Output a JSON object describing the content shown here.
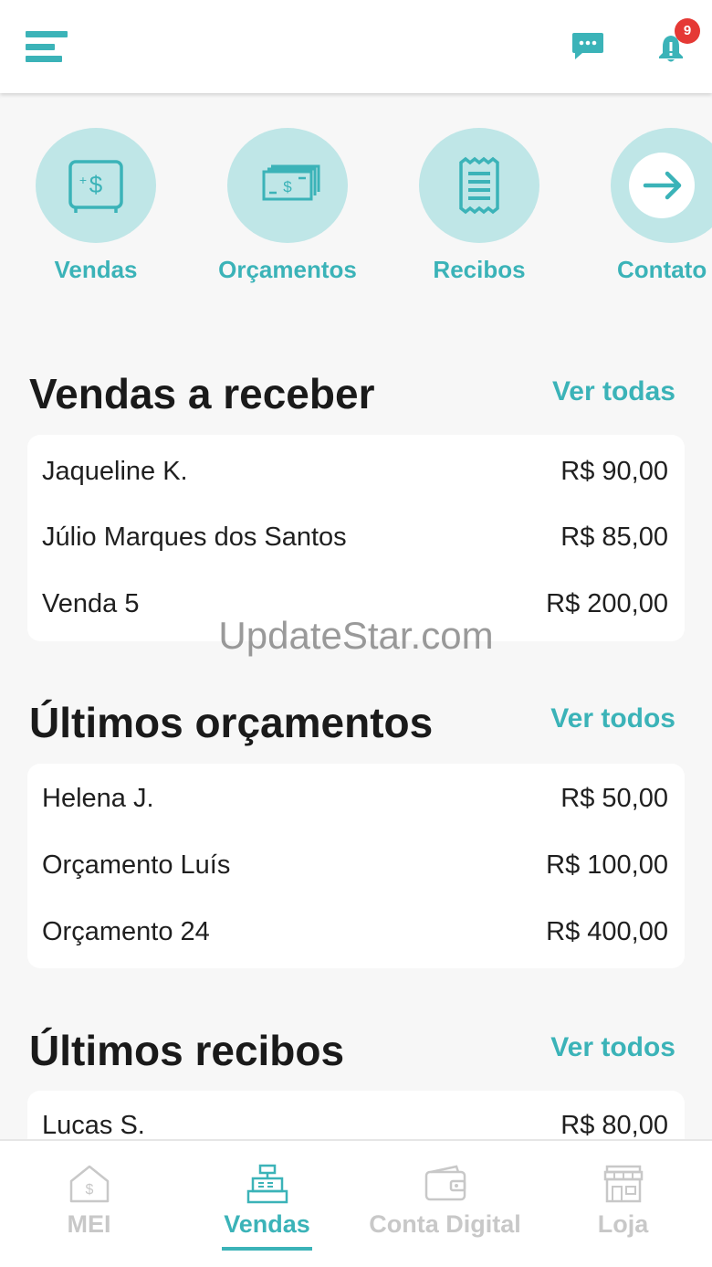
{
  "header": {
    "menu_icon": "hamburger-menu-icon",
    "chat_icon": "chat-bubble-icon",
    "bell_icon": "bell-icon",
    "notification_count": "9",
    "accent": "#3bb3b8",
    "badge_color": "#e53935"
  },
  "shortcuts": [
    {
      "label": "Vendas",
      "icon": "safe-money-icon"
    },
    {
      "label": "Orçamentos",
      "icon": "banknotes-icon"
    },
    {
      "label": "Recibos",
      "icon": "receipt-icon"
    },
    {
      "label": "Contato",
      "icon": "arrow-right-icon"
    }
  ],
  "sales": {
    "title": "Vendas a receber",
    "see_all": "Ver todas",
    "rows": [
      {
        "name": "Jaqueline K.",
        "amount": "R$ 90,00"
      },
      {
        "name": "Júlio Marques dos Santos",
        "amount": "R$ 85,00"
      },
      {
        "name": "Venda 5",
        "amount": "R$ 200,00"
      }
    ]
  },
  "quotes": {
    "title": "Últimos orçamentos",
    "see_all": "Ver todos",
    "rows": [
      {
        "name": "Helena J.",
        "amount": "R$ 50,00"
      },
      {
        "name": "Orçamento Luís",
        "amount": "R$ 100,00"
      },
      {
        "name": "Orçamento 24",
        "amount": "R$ 400,00"
      }
    ]
  },
  "receipts": {
    "title": "Últimos recibos",
    "see_all": "Ver todos",
    "rows": [
      {
        "name": "Lucas S.",
        "amount": "R$ 80,00"
      }
    ]
  },
  "watermark": "UpdateStar.com",
  "bottom_nav": [
    {
      "label": "MEI",
      "icon": "house-money-icon",
      "active": false
    },
    {
      "label": "Vendas",
      "icon": "cash-register-icon",
      "active": true
    },
    {
      "label": "Conta Digital",
      "icon": "wallet-icon",
      "active": false
    },
    {
      "label": "Loja",
      "icon": "storefront-icon",
      "active": false
    }
  ]
}
